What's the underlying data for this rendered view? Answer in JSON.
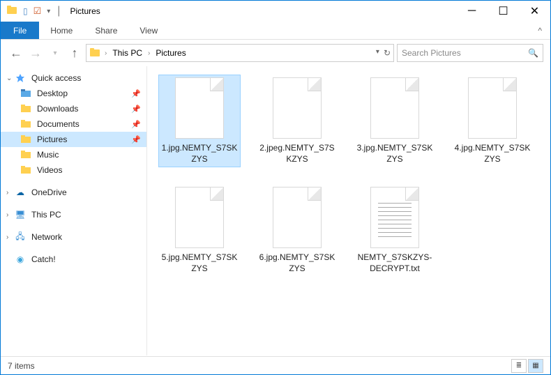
{
  "window": {
    "title": "Pictures",
    "minimize": "─",
    "maximize": "☐",
    "close": "✕"
  },
  "quickAccess": {
    "qa1": "▯",
    "qa2": "☑",
    "qadown": "▾"
  },
  "ribbon": {
    "file": "File",
    "tabs": [
      "Home",
      "Share",
      "View"
    ],
    "expand": "^"
  },
  "nav": {
    "refresh": "↻"
  },
  "breadcrumb": {
    "items": [
      "This PC",
      "Pictures"
    ],
    "sep": "›"
  },
  "search": {
    "placeholder": "Search Pictures",
    "icon": "🔍"
  },
  "sidebar": {
    "quick": {
      "label": "Quick access",
      "items": [
        "Desktop",
        "Downloads",
        "Documents",
        "Pictures",
        "Music",
        "Videos"
      ]
    },
    "onedrive": "OneDrive",
    "thispc": "This PC",
    "network": "Network",
    "catch": "Catch!"
  },
  "files": [
    {
      "name": "1.jpg.NEMTY_S7SKZYS",
      "type": "blank",
      "selected": true
    },
    {
      "name": "2.jpeg.NEMTY_S7SKZYS",
      "type": "blank",
      "selected": false
    },
    {
      "name": "3.jpg.NEMTY_S7SKZYS",
      "type": "blank",
      "selected": false
    },
    {
      "name": "4.jpg.NEMTY_S7SKZYS",
      "type": "blank",
      "selected": false
    },
    {
      "name": "5.jpg.NEMTY_S7SKZYS",
      "type": "blank",
      "selected": false
    },
    {
      "name": "6.jpg.NEMTY_S7SKZYS",
      "type": "blank",
      "selected": false
    },
    {
      "name": "NEMTY_S7SKZYS-DECRYPT.txt",
      "type": "txt",
      "selected": false
    }
  ],
  "status": {
    "count": "7 items"
  }
}
